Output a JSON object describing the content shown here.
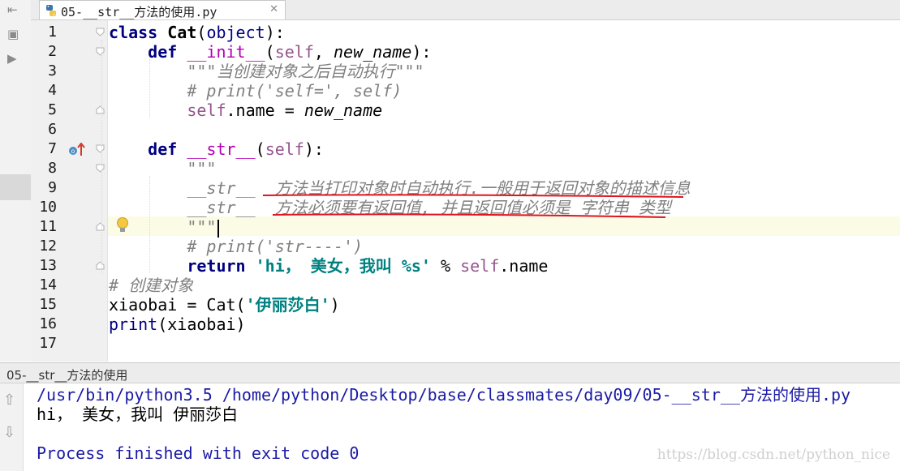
{
  "editor_tab": {
    "filename": "05-__str__方法的使用.py",
    "close_icon": "close-icon",
    "file_icon": "python-file-icon"
  },
  "line_numbers": [
    "1",
    "2",
    "3",
    "4",
    "5",
    "6",
    "7",
    "8",
    "9",
    "10",
    "11",
    "12",
    "13",
    "14",
    "15",
    "16",
    "17"
  ],
  "current_line": "11",
  "code": {
    "l1": {
      "kw": "class",
      "name": "Cat",
      "open": "(",
      "base": "object",
      "close": "):"
    },
    "l2": {
      "kw": "def",
      "name": "__init__",
      "open": "(",
      "self": "self",
      "comma": ", ",
      "param": "new_name",
      "close": "):"
    },
    "l3": {
      "doc": "\"\"\"当创建对象之后自动执行\"\"\""
    },
    "l4": {
      "cmt": "# print('self=', self)"
    },
    "l5": {
      "self": "self",
      "attr": ".name = ",
      "param": "new_name"
    },
    "l7": {
      "kw": "def",
      "name": "__str__",
      "open": "(",
      "self": "self",
      "close": "):"
    },
    "l8": {
      "doc": "\"\"\""
    },
    "l9": {
      "doc": "__str__  方法当打印对象时自动执行.一般用于返回对象的描述信息"
    },
    "l10": {
      "doc": "__str__  方法必须要有返回值, 并且返回值必须是 字符串 类型"
    },
    "l11": {
      "doc": "\"\"\""
    },
    "l12": {
      "cmt": "# print('str----')"
    },
    "l13": {
      "kw": "return",
      "str": "'hi， 美女，我叫 %s'",
      "op": " % ",
      "self": "self",
      "attr": ".name"
    },
    "l14": {
      "cmt": "# 创建对象"
    },
    "l15": {
      "var": "xiaobai = Cat(",
      "str": "'伊丽莎白'",
      "close": ")"
    },
    "l16": {
      "builtin": "print",
      "rest": "(xiaobai)"
    }
  },
  "run_panel": {
    "title": "05-__str__方法的使用",
    "command": "/usr/bin/python3.5 /home/python/Desktop/base/classmates/day09/05-__str__方法的使用.py",
    "output": "hi， 美女，我叫 伊丽莎白",
    "exit": "Process finished with exit code 0",
    "rerun_icon": "arrow-up-icon",
    "down_icon": "arrow-down-icon"
  },
  "watermark": "https://blog.csdn.net/python_nice",
  "colors": {
    "keyword": "#000080",
    "magic": "#b200b2",
    "self": "#94558d",
    "string": "#008080",
    "comment": "#808080",
    "underline": "#e0141e",
    "current_line": "#fbfbe6"
  }
}
